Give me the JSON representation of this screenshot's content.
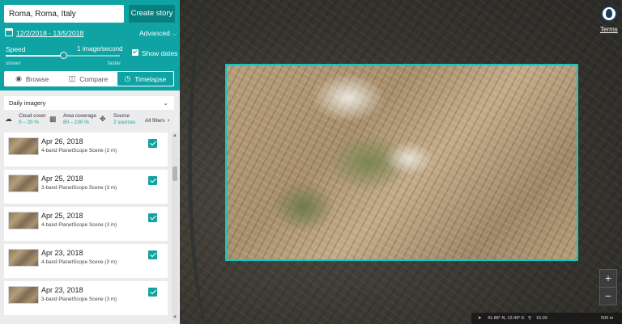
{
  "search": {
    "value": "Roma, Roma, Italy"
  },
  "create_story_label": "Create story",
  "date_range": "12/2/2018 - 13/5/2018",
  "advanced_label": "Advanced",
  "speed": {
    "label": "Speed",
    "value_text": "1 image/second",
    "slower_label": "slower",
    "faster_label": "faster",
    "level": 0.5
  },
  "show_dates": {
    "label": "Show dates",
    "checked": true
  },
  "tabs": [
    {
      "label": "Browse",
      "icon": "eye-icon",
      "active": false
    },
    {
      "label": "Compare",
      "icon": "compare-icon",
      "active": false
    },
    {
      "label": "Timelapse",
      "icon": "timelapse-icon",
      "active": true
    }
  ],
  "imagery_select": {
    "value": "Daily imagery"
  },
  "filters": {
    "cloud_cover": {
      "label": "Cloud cover",
      "value": "0 – 20 %",
      "icon": "cloud-icon"
    },
    "area_coverage": {
      "label": "Area coverage",
      "value": "80 – 100 %",
      "icon": "area-icon"
    },
    "source": {
      "label": "Source",
      "value": "2 sources",
      "icon": "satellite-icon"
    },
    "all_filters_label": "All filters"
  },
  "results": [
    {
      "date": "Apr 26, 2018",
      "type": "4-band PlanetScope Scene (3 m)",
      "checked": true
    },
    {
      "date": "Apr 25, 2018",
      "type": "3-band PlanetScope Scene (3 m)",
      "checked": true
    },
    {
      "date": "Apr 25, 2018",
      "type": "4-band PlanetScope Scene (3 m)",
      "checked": true
    },
    {
      "date": "Apr 23, 2018",
      "type": "4-band PlanetScope Scene (3 m)",
      "checked": true
    },
    {
      "date": "Apr 23, 2018",
      "type": "3-band PlanetScope Scene (3 m)",
      "checked": true
    }
  ],
  "map": {
    "terms_label": "Terms",
    "zoom_in": "+",
    "zoom_out": "−",
    "coordinates": "41.88° N, 12.49° E",
    "zoom_level": "15.00",
    "scale_label": "500 m"
  },
  "colors": {
    "accent": "#10a3a3",
    "aoi_border": "#12c8c0"
  }
}
